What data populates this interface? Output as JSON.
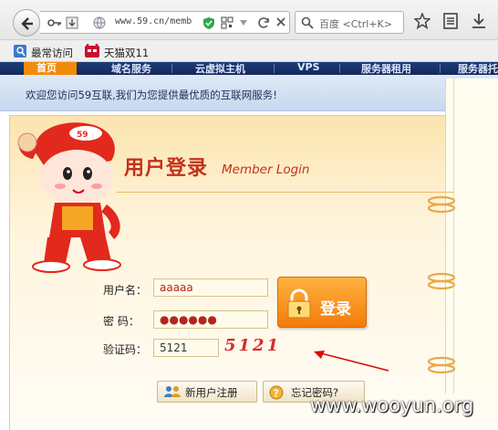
{
  "browser": {
    "url": "www.59.cn/memb",
    "search_placeholder": "百度 <Ctrl+K>",
    "bookmarks": [
      {
        "label": "最常访问"
      },
      {
        "label": "天猫双11"
      }
    ]
  },
  "site": {
    "nav": {
      "home": "首页",
      "items": [
        "域名服务",
        "云虚拟主机",
        "VPS",
        "服务器租用",
        "服务器托"
      ]
    },
    "welcome": "欢迎您访问59互联,我们为您提供最优质的互联网服务!"
  },
  "login": {
    "title_cn": "用户登录",
    "title_en": "Member Login",
    "username_label": "用户名：",
    "username_value": "aaaaa",
    "password_label": "密  码：",
    "password_value": "●●●●●●",
    "captcha_label": "验证码：",
    "captcha_value": "5121",
    "captcha_image_text": "5121",
    "submit_label": "登录",
    "register_label": "新用户注册",
    "forgot_label": "忘记密码?"
  },
  "watermark": "www.wooyun.org",
  "colors": {
    "accent": "#f28a0b",
    "title_red": "#c4311d",
    "nav_bg": "#1d3c78"
  }
}
